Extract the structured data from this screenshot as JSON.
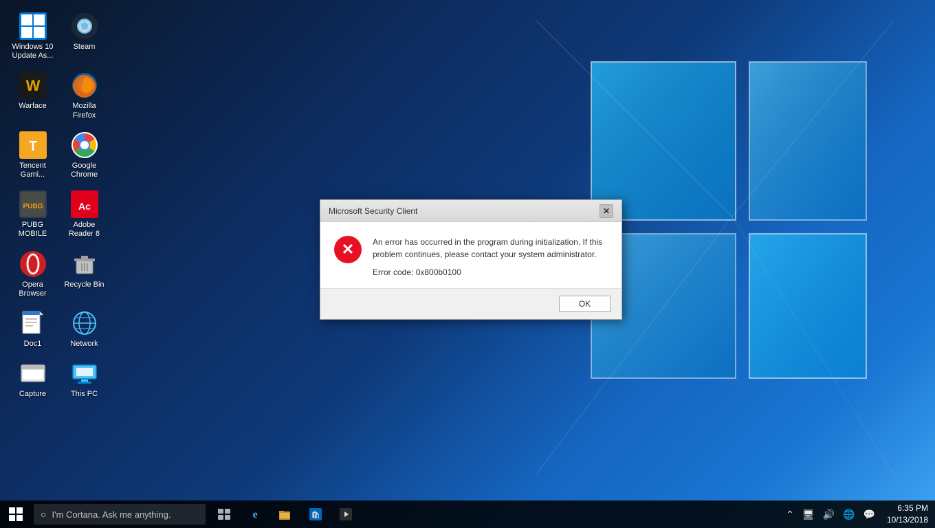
{
  "desktop": {
    "background": "Windows 10 desktop",
    "icons": [
      {
        "id": "win10-update",
        "label": "Windows 10 Update As...",
        "icon": "🪟",
        "row": 0,
        "col": 0
      },
      {
        "id": "steam",
        "label": "Steam",
        "icon": "🎮",
        "row": 0,
        "col": 1
      },
      {
        "id": "warface",
        "label": "Warface",
        "icon": "🎯",
        "row": 1,
        "col": 0
      },
      {
        "id": "firefox",
        "label": "Mozilla Firefox",
        "icon": "🦊",
        "row": 1,
        "col": 1
      },
      {
        "id": "tencent",
        "label": "Tencent Gami...",
        "icon": "🎲",
        "row": 2,
        "col": 0
      },
      {
        "id": "chrome",
        "label": "Google Chrome",
        "icon": "🌐",
        "row": 2,
        "col": 1
      },
      {
        "id": "pubg",
        "label": "PUBG MOBILE",
        "icon": "🔫",
        "row": 3,
        "col": 0
      },
      {
        "id": "adobe",
        "label": "Adobe Reader 8",
        "icon": "📄",
        "row": 3,
        "col": 1
      },
      {
        "id": "opera",
        "label": "Opera Browser",
        "icon": "O",
        "row": 4,
        "col": 0
      },
      {
        "id": "recycle",
        "label": "Recycle Bin",
        "icon": "🗑",
        "row": 4,
        "col": 1
      },
      {
        "id": "doc1",
        "label": "Doc1",
        "icon": "📝",
        "row": 5,
        "col": 0
      },
      {
        "id": "network",
        "label": "Network",
        "icon": "🖧",
        "row": 5,
        "col": 1
      },
      {
        "id": "capture",
        "label": "Capture",
        "icon": "📷",
        "row": 6,
        "col": 0
      },
      {
        "id": "thispc",
        "label": "This PC",
        "icon": "💻",
        "row": 6,
        "col": 1
      }
    ]
  },
  "dialog": {
    "title": "Microsoft Security Client",
    "message": "An error has occurred in the program during initialization. If this problem continues, please contact your system administrator.",
    "error_code_label": "Error code: 0x800b0100",
    "ok_button": "OK",
    "close_button": "✕"
  },
  "taskbar": {
    "search_placeholder": "I'm Cortana. Ask me anything.",
    "time": "6:35 PM",
    "date": "10/13/2018"
  }
}
